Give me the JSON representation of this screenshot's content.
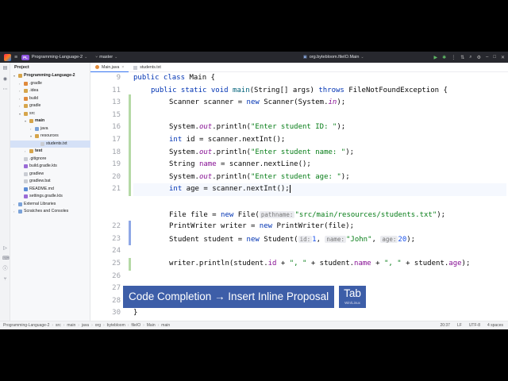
{
  "titlebar": {
    "project_badge": "PL",
    "project_name": "Programming-Language-2",
    "branch": "master",
    "run_config": "org.bytebloom.fileIO.Main"
  },
  "project_panel": {
    "header": "Project",
    "tree": [
      {
        "label": "Programming-Language-2",
        "indent": 0,
        "arrow": "▾",
        "kind": "fo",
        "bold": true
      },
      {
        "label": ".gradle",
        "indent": 1,
        "arrow": "›",
        "kind": "fo-orange"
      },
      {
        "label": ".idea",
        "indent": 1,
        "arrow": "›",
        "kind": "fo"
      },
      {
        "label": "build",
        "indent": 1,
        "arrow": "›",
        "kind": "fo-orange"
      },
      {
        "label": "gradle",
        "indent": 1,
        "arrow": "›",
        "kind": "fo"
      },
      {
        "label": "src",
        "indent": 1,
        "arrow": "▾",
        "kind": "fo"
      },
      {
        "label": "main",
        "indent": 2,
        "arrow": "▾",
        "kind": "fo",
        "bold": true
      },
      {
        "label": "java",
        "indent": 3,
        "arrow": "›",
        "kind": "fo-b"
      },
      {
        "label": "resources",
        "indent": 3,
        "arrow": "▾",
        "kind": "fo"
      },
      {
        "label": "students.txt",
        "indent": 4,
        "arrow": "",
        "kind": "fl",
        "selected": true
      },
      {
        "label": "test",
        "indent": 2,
        "arrow": "›",
        "kind": "fo",
        "bold": true
      },
      {
        "label": ".gitignore",
        "indent": 1,
        "arrow": "",
        "kind": "fl"
      },
      {
        "label": "build.gradle.kts",
        "indent": 1,
        "arrow": "",
        "kind": "fl-kt"
      },
      {
        "label": "gradlew",
        "indent": 1,
        "arrow": "",
        "kind": "fl"
      },
      {
        "label": "gradlew.bat",
        "indent": 1,
        "arrow": "",
        "kind": "fl"
      },
      {
        "label": "README.md",
        "indent": 1,
        "arrow": "",
        "kind": "fl-md"
      },
      {
        "label": "settings.gradle.kts",
        "indent": 1,
        "arrow": "",
        "kind": "fl-kt"
      },
      {
        "label": "External Libraries",
        "indent": 0,
        "arrow": "›",
        "kind": "fo-b"
      },
      {
        "label": "Scratches and Consoles",
        "indent": 0,
        "arrow": "›",
        "kind": "fo-b"
      }
    ]
  },
  "tabs": [
    {
      "label": "Main.java",
      "active": true
    },
    {
      "label": "students.txt",
      "active": false
    }
  ],
  "editor": {
    "line_numbers": [
      "9",
      "11",
      "13",
      "15",
      "16",
      "17",
      "18",
      "19",
      "20",
      "21",
      "28",
      "22",
      "23",
      "24",
      "25",
      "26",
      "27",
      "28",
      "30"
    ],
    "current_line": "28",
    "code": {
      "l9_kw": "public class",
      "l9_name": " Main {",
      "l11_a": "public static void ",
      "l11_fn": "main",
      "l11_b": "(String[] args) ",
      "l11_kw": "throws",
      "l11_c": " FileNotFoundException {",
      "l13_a": "Scanner scanner = ",
      "l13_kw": "new",
      "l13_b": " Scanner(System.",
      "l13_it": "in",
      "l13_c": ");",
      "sys": "System.",
      "out": "out",
      "println": ".println(",
      "l16_st": "\"Enter student ID: \"",
      "close": ");",
      "int_kw": "int",
      "l17_a": " id = scanner.nextInt();",
      "l18_st": "\"Enter student name: \"",
      "l19_a": "String ",
      "l19_var": "name",
      "l19_b": " = scanner.nextLine();",
      "l20_st": "\"Enter student age: \"",
      "l21_a": " age = scanner.nextInt();",
      "l22_a": "File file = ",
      "l22_kw": "new",
      "l22_b": " File(",
      "l22_hint": "pathname:",
      "l22_st": "\"src/main/resources/students.txt\"",
      "l22_c": ");",
      "l23_a": "PrintWriter writer = ",
      "l23_kw": "new",
      "l23_b": " PrintWriter(file);",
      "l24_a": "Student student = ",
      "l24_kw": "new",
      "l24_b": " Student(",
      "l24_h1": "id:",
      "l24_n1": "1",
      "l24_sep1": ", ",
      "l24_h2": "name:",
      "l24_st": "\"John\"",
      "l24_sep2": ", ",
      "l24_h3": "age:",
      "l24_n3": "20",
      "l24_c": ");",
      "l26_a": "writer.println(student.",
      "l26_v1": "id",
      "l26_b": " + ",
      "l26_s1": "\", \"",
      "l26_c": " + student.",
      "l26_v2": "name",
      "l26_d": " + ",
      "l26_s2": "\", \"",
      "l26_e": " + student.",
      "l26_v3": "age",
      "l26_f": ");",
      "l30_a": "}"
    }
  },
  "statusbar": {
    "crumbs": [
      "Programming-Language-2",
      "src",
      "main",
      "java",
      "org",
      "bytebloom",
      "fileIO",
      "Main",
      "main"
    ],
    "position": "20:37",
    "line_sep": "LF",
    "encoding": "UTF-8",
    "indent": "4 spaces"
  },
  "overlay": {
    "action": "Code Completion → Insert Inline Proposal",
    "key": "Tab",
    "platform": "Win/Linux"
  },
  "colors": {
    "keyword": "#0033b3",
    "string": "#067d17",
    "method": "#00627a",
    "field": "#871094",
    "number": "#1750eb",
    "overlay_bg": "#3d5ea8"
  }
}
